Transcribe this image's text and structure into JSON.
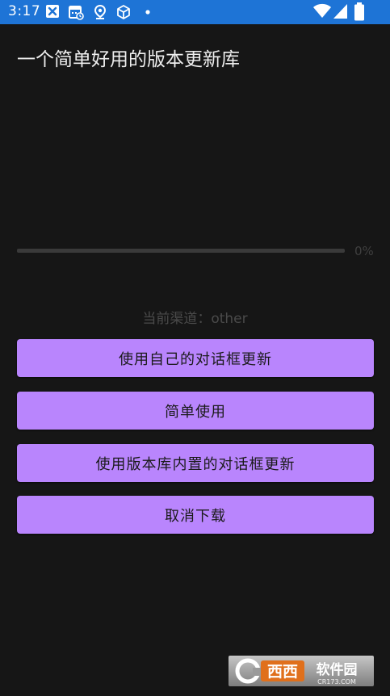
{
  "status_bar": {
    "time": "3:17",
    "left_icons": [
      "x-notification-icon",
      "calendar-icon",
      "location-icon",
      "box-icon",
      "dot-icon"
    ],
    "right_icons": [
      "wifi-icon",
      "signal-icon",
      "battery-icon"
    ],
    "background_color": "#1e74d6"
  },
  "app": {
    "title": "一个简单好用的版本更新库"
  },
  "progress": {
    "value": 0,
    "percent_label": "0%"
  },
  "channel": {
    "text": "当前渠道：other"
  },
  "buttons": [
    {
      "label": "使用自己的对话框更新"
    },
    {
      "label": "简单使用"
    },
    {
      "label": "使用版本库内置的对话框更新"
    },
    {
      "label": "取消下载"
    }
  ],
  "colors": {
    "accent": "#b985fd",
    "background": "#161616"
  },
  "watermark": {
    "text_main": "西西软件园",
    "text_sub": "CR173.COM"
  }
}
